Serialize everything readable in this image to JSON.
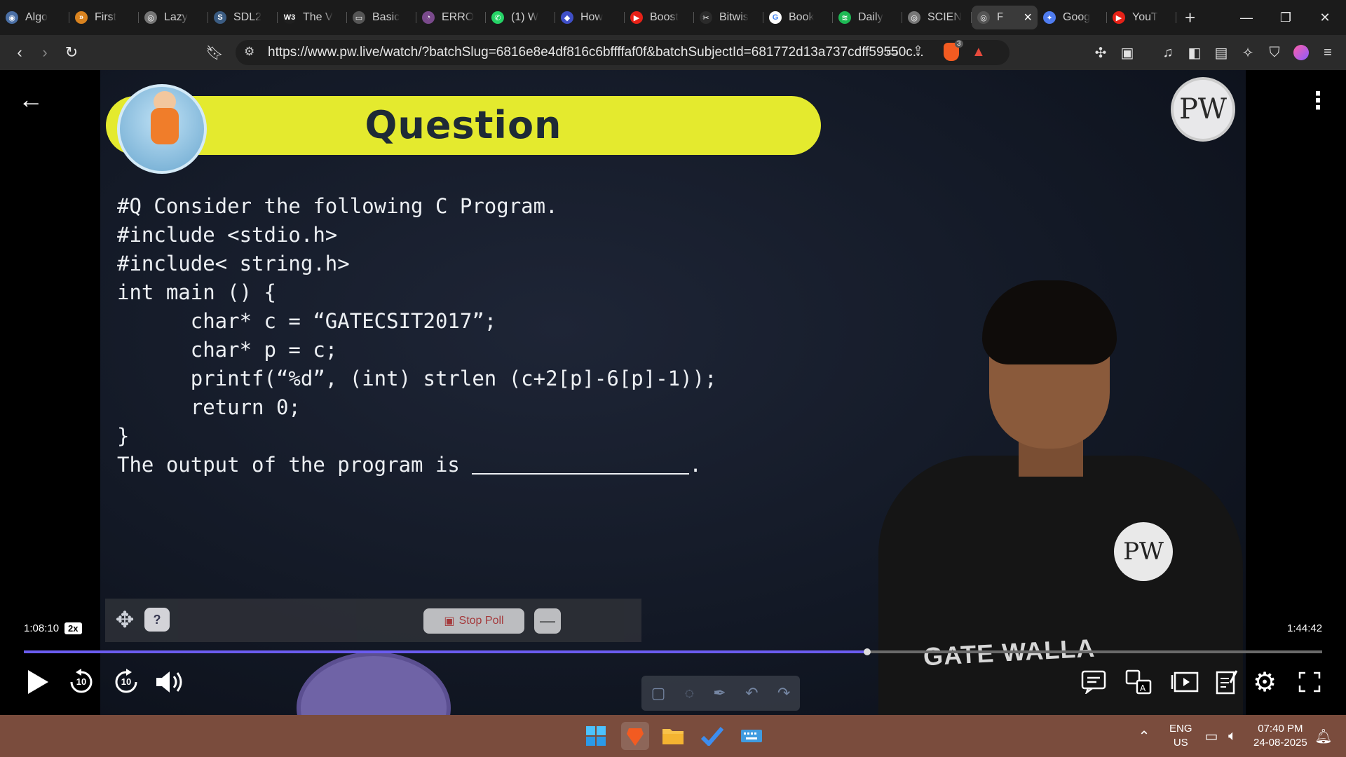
{
  "browser": {
    "tabs": [
      {
        "title": "Algo",
        "color": "#4a6fa5",
        "glyph": "◉"
      },
      {
        "title": "First",
        "color": "#d9831f",
        "glyph": "»"
      },
      {
        "title": "Lazy",
        "color": "#777777",
        "glyph": "◎"
      },
      {
        "title": "SDL2",
        "color": "#3b5c82",
        "glyph": "S"
      },
      {
        "title": "The V",
        "color": "#1f1f1f",
        "glyph": "W3"
      },
      {
        "title": "Basic",
        "color": "#555555",
        "glyph": "▭"
      },
      {
        "title": "ERRO",
        "color": "#7a4a8c",
        "glyph": "◔"
      },
      {
        "title": "(1) W",
        "color": "#25d366",
        "glyph": "✆"
      },
      {
        "title": "How",
        "color": "#3f4fc7",
        "glyph": "◆"
      },
      {
        "title": "Boost",
        "color": "#e62117",
        "glyph": "▶"
      },
      {
        "title": "Bitwis",
        "color": "#2b2b2b",
        "glyph": "✂"
      },
      {
        "title": "Book",
        "color": "#ffffff",
        "glyph": "G"
      },
      {
        "title": "Daily",
        "color": "#1db954",
        "glyph": "≋"
      },
      {
        "title": "SCIEN",
        "color": "#777777",
        "glyph": "◎"
      },
      {
        "title": "F",
        "color": "#555555",
        "glyph": "◎"
      },
      {
        "title": "Goog",
        "color": "#4f7cf0",
        "glyph": "✦"
      },
      {
        "title": "YouT",
        "color": "#e62117",
        "glyph": "▶"
      }
    ],
    "url": "https://www.pw.live/watch/?batchSlug=6816e8e4df816c6bffffaf0f&batchSubjectId=681772d13a737cdff59550c...",
    "brave_badge": "3"
  },
  "video": {
    "banner_title": "Question",
    "code_lines": [
      "#Q Consider the following C Program.",
      "#include <stdio.h>",
      "#include< string.h>",
      "int main () {",
      "      char* c = “GATECSIT2017”;",
      "      char* p = c;",
      "      printf(“%d”, (int) strlen (c+2[p]-6[p]-1));",
      "      return 0;",
      "}"
    ],
    "output_line": "The output of the program is ",
    "output_end": ".",
    "logo_text": "PW",
    "shirt_text": "GATE WALLA",
    "stop_poll_label": "Stop Poll",
    "help_label": "?"
  },
  "player": {
    "current_time": "1:08:10",
    "speed": "2x",
    "total_time": "1:44:42",
    "progress": 0.6497,
    "skip_back": "10",
    "skip_fwd": "10"
  },
  "taskbar": {
    "lang_line1": "ENG",
    "lang_line2": "US",
    "time": "07:40 PM",
    "date": "24-08-2025"
  }
}
